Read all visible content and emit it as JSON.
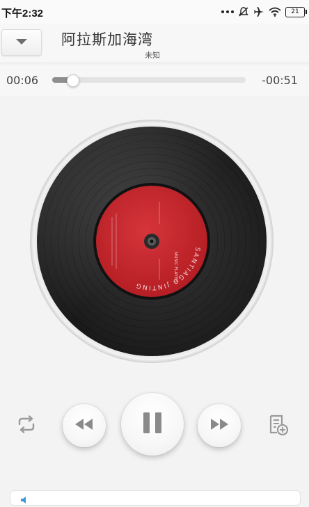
{
  "status_bar": {
    "time": "下午2:32",
    "battery_level": "21",
    "icons": [
      "more-dots-icon",
      "notifications-off-icon",
      "airplane-icon",
      "wifi-icon",
      "battery-icon"
    ]
  },
  "header": {
    "title": "阿拉斯加海湾",
    "artist": "未知",
    "collapse_icon": "chevron-down-icon"
  },
  "progress": {
    "elapsed": "00:06",
    "remaining": "-00:51",
    "fraction": 0.105
  },
  "record": {
    "label_color": "#c8232a",
    "label_text_outer": "SANTIAGO JINTING",
    "label_text_inner": "MUSIC PLAYER"
  },
  "controls": {
    "repeat_icon": "repeat-icon",
    "previous_icon": "rewind-icon",
    "play_pause_icon": "pause-icon",
    "next_icon": "fast-forward-icon",
    "add_playlist_icon": "playlist-add-icon"
  },
  "colors": {
    "background": "#f3f3f3",
    "accent_icon": "#9a9a9a",
    "progress_fill": "#8e8e8e"
  }
}
